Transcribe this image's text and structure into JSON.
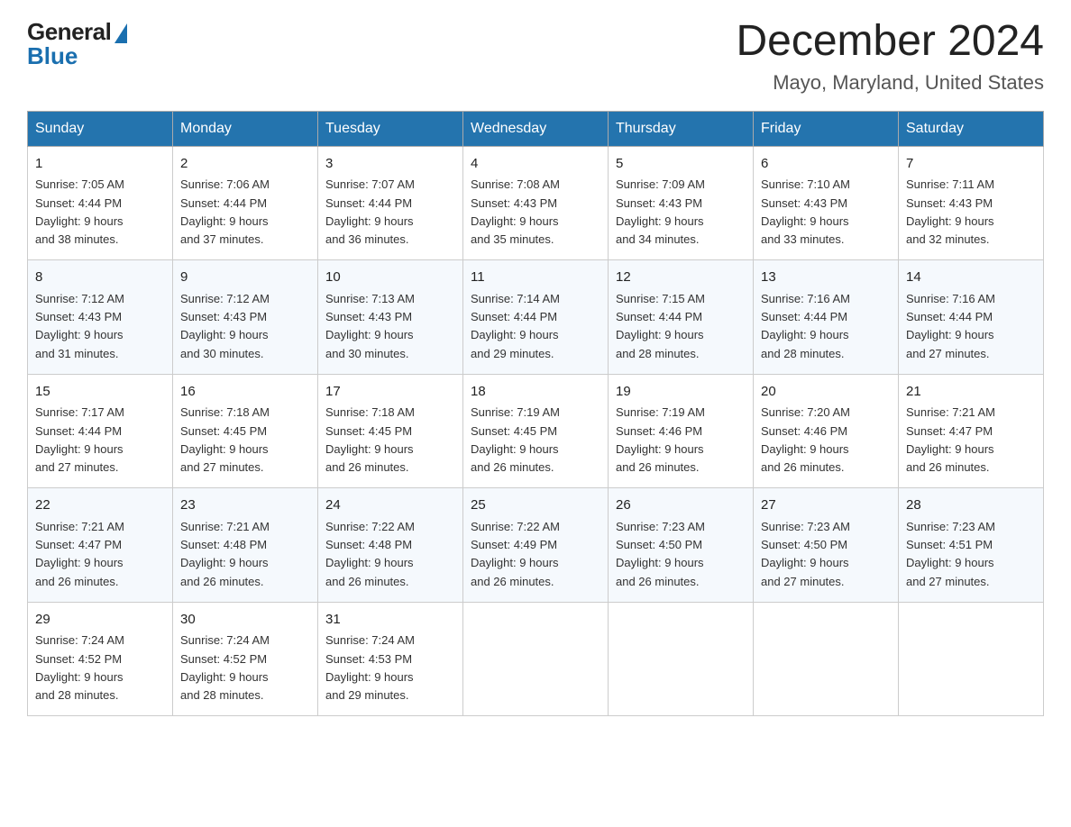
{
  "logo": {
    "general": "General",
    "blue": "Blue"
  },
  "title": "December 2024",
  "location": "Mayo, Maryland, United States",
  "days_of_week": [
    "Sunday",
    "Monday",
    "Tuesday",
    "Wednesday",
    "Thursday",
    "Friday",
    "Saturday"
  ],
  "weeks": [
    [
      {
        "day": "1",
        "sunrise": "7:05 AM",
        "sunset": "4:44 PM",
        "daylight": "9 hours and 38 minutes."
      },
      {
        "day": "2",
        "sunrise": "7:06 AM",
        "sunset": "4:44 PM",
        "daylight": "9 hours and 37 minutes."
      },
      {
        "day": "3",
        "sunrise": "7:07 AM",
        "sunset": "4:44 PM",
        "daylight": "9 hours and 36 minutes."
      },
      {
        "day": "4",
        "sunrise": "7:08 AM",
        "sunset": "4:43 PM",
        "daylight": "9 hours and 35 minutes."
      },
      {
        "day": "5",
        "sunrise": "7:09 AM",
        "sunset": "4:43 PM",
        "daylight": "9 hours and 34 minutes."
      },
      {
        "day": "6",
        "sunrise": "7:10 AM",
        "sunset": "4:43 PM",
        "daylight": "9 hours and 33 minutes."
      },
      {
        "day": "7",
        "sunrise": "7:11 AM",
        "sunset": "4:43 PM",
        "daylight": "9 hours and 32 minutes."
      }
    ],
    [
      {
        "day": "8",
        "sunrise": "7:12 AM",
        "sunset": "4:43 PM",
        "daylight": "9 hours and 31 minutes."
      },
      {
        "day": "9",
        "sunrise": "7:12 AM",
        "sunset": "4:43 PM",
        "daylight": "9 hours and 30 minutes."
      },
      {
        "day": "10",
        "sunrise": "7:13 AM",
        "sunset": "4:43 PM",
        "daylight": "9 hours and 30 minutes."
      },
      {
        "day": "11",
        "sunrise": "7:14 AM",
        "sunset": "4:44 PM",
        "daylight": "9 hours and 29 minutes."
      },
      {
        "day": "12",
        "sunrise": "7:15 AM",
        "sunset": "4:44 PM",
        "daylight": "9 hours and 28 minutes."
      },
      {
        "day": "13",
        "sunrise": "7:16 AM",
        "sunset": "4:44 PM",
        "daylight": "9 hours and 28 minutes."
      },
      {
        "day": "14",
        "sunrise": "7:16 AM",
        "sunset": "4:44 PM",
        "daylight": "9 hours and 27 minutes."
      }
    ],
    [
      {
        "day": "15",
        "sunrise": "7:17 AM",
        "sunset": "4:44 PM",
        "daylight": "9 hours and 27 minutes."
      },
      {
        "day": "16",
        "sunrise": "7:18 AM",
        "sunset": "4:45 PM",
        "daylight": "9 hours and 27 minutes."
      },
      {
        "day": "17",
        "sunrise": "7:18 AM",
        "sunset": "4:45 PM",
        "daylight": "9 hours and 26 minutes."
      },
      {
        "day": "18",
        "sunrise": "7:19 AM",
        "sunset": "4:45 PM",
        "daylight": "9 hours and 26 minutes."
      },
      {
        "day": "19",
        "sunrise": "7:19 AM",
        "sunset": "4:46 PM",
        "daylight": "9 hours and 26 minutes."
      },
      {
        "day": "20",
        "sunrise": "7:20 AM",
        "sunset": "4:46 PM",
        "daylight": "9 hours and 26 minutes."
      },
      {
        "day": "21",
        "sunrise": "7:21 AM",
        "sunset": "4:47 PM",
        "daylight": "9 hours and 26 minutes."
      }
    ],
    [
      {
        "day": "22",
        "sunrise": "7:21 AM",
        "sunset": "4:47 PM",
        "daylight": "9 hours and 26 minutes."
      },
      {
        "day": "23",
        "sunrise": "7:21 AM",
        "sunset": "4:48 PM",
        "daylight": "9 hours and 26 minutes."
      },
      {
        "day": "24",
        "sunrise": "7:22 AM",
        "sunset": "4:48 PM",
        "daylight": "9 hours and 26 minutes."
      },
      {
        "day": "25",
        "sunrise": "7:22 AM",
        "sunset": "4:49 PM",
        "daylight": "9 hours and 26 minutes."
      },
      {
        "day": "26",
        "sunrise": "7:23 AM",
        "sunset": "4:50 PM",
        "daylight": "9 hours and 26 minutes."
      },
      {
        "day": "27",
        "sunrise": "7:23 AM",
        "sunset": "4:50 PM",
        "daylight": "9 hours and 27 minutes."
      },
      {
        "day": "28",
        "sunrise": "7:23 AM",
        "sunset": "4:51 PM",
        "daylight": "9 hours and 27 minutes."
      }
    ],
    [
      {
        "day": "29",
        "sunrise": "7:24 AM",
        "sunset": "4:52 PM",
        "daylight": "9 hours and 28 minutes."
      },
      {
        "day": "30",
        "sunrise": "7:24 AM",
        "sunset": "4:52 PM",
        "daylight": "9 hours and 28 minutes."
      },
      {
        "day": "31",
        "sunrise": "7:24 AM",
        "sunset": "4:53 PM",
        "daylight": "9 hours and 29 minutes."
      },
      null,
      null,
      null,
      null
    ]
  ],
  "labels": {
    "sunrise": "Sunrise:",
    "sunset": "Sunset:",
    "daylight": "Daylight:"
  }
}
